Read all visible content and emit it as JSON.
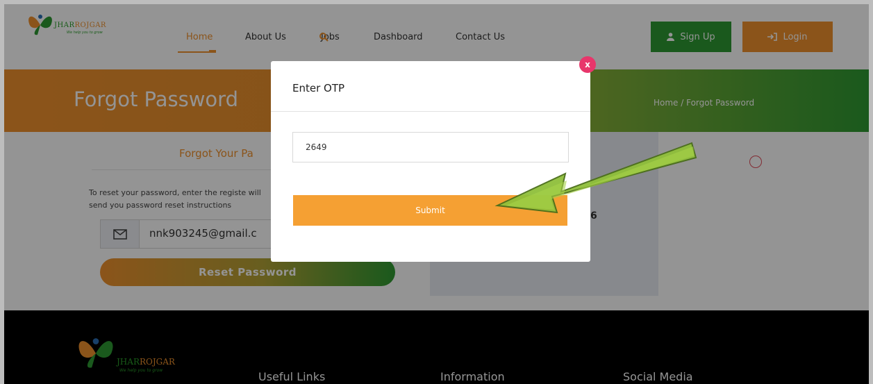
{
  "brand": {
    "name_part1": "JHAR",
    "name_part2": "ROJGAR",
    "tagline": "We help you to grow"
  },
  "nav": {
    "items": [
      "Home",
      "About Us",
      "Jobs",
      "Dashboard",
      "Contact Us"
    ],
    "active": "Home",
    "signup_label": "Sign Up",
    "login_label": "Login"
  },
  "banner": {
    "title": "Forgot Password",
    "breadcrumb": "Home  /  Forgot Password"
  },
  "form": {
    "heading": "Forgot Your Pa",
    "instructions": "To reset your password, enter the registe will send you password reset instructions",
    "email_value": "nnk903245@gmail.c",
    "reset_label": "Reset Password",
    "captcha_digit": "6"
  },
  "modal": {
    "title": "Enter OTP",
    "otp_value": "2649",
    "submit_label": "Submit",
    "close_label": "x"
  },
  "footer": {
    "headings": [
      "Useful Links",
      "Information",
      "Social Media"
    ]
  },
  "colors": {
    "accent_orange": "#f0922e",
    "accent_green": "#2e9a32",
    "close_pink": "#e8366b",
    "annotation_arrow": "#8fbf3a"
  }
}
